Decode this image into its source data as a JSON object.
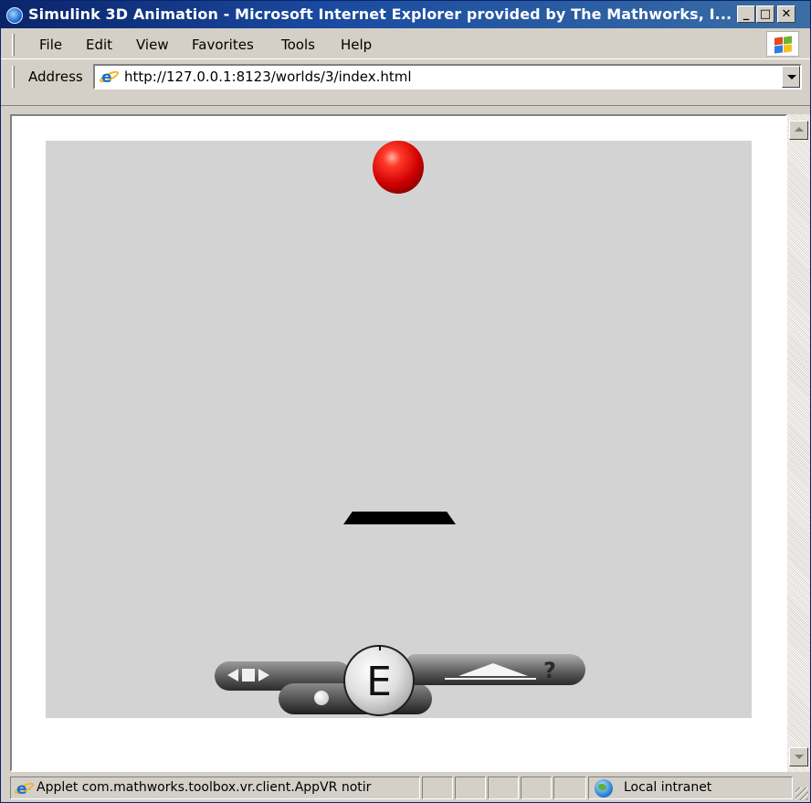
{
  "window": {
    "title": "Simulink 3D Animation - Microsoft Internet Explorer provided by The Mathworks, I...",
    "controls": {
      "minimize": "_",
      "maximize": "□",
      "close": "✕"
    }
  },
  "menu": {
    "items": [
      {
        "label": "File"
      },
      {
        "label": "Edit"
      },
      {
        "label": "View"
      },
      {
        "label": "Favorites"
      },
      {
        "label": "Tools"
      },
      {
        "label": "Help"
      }
    ]
  },
  "address": {
    "label": "Address",
    "url": "http://127.0.0.1:8123/worlds/3/index.html"
  },
  "viewer": {
    "background": "#d3d3d3",
    "ball_color": "#d00000",
    "navigation": {
      "compass_letter": "E",
      "help_glyph": "?"
    }
  },
  "status": {
    "message": "Applet com.mathworks.toolbox.vr.client.AppVR notir",
    "zone": "Local intranet"
  },
  "icons": {
    "app": "internet-explorer-icon",
    "throbber": "windows-logo-icon",
    "page": "internet-explorer-page-icon",
    "zone": "local-intranet-globe-icon"
  }
}
